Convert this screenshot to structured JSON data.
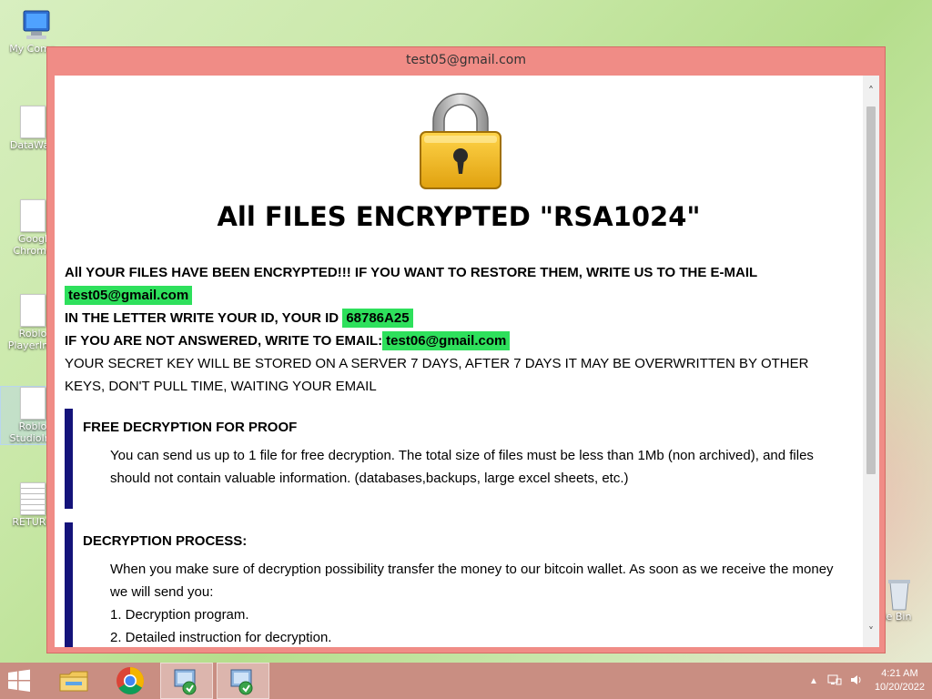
{
  "window": {
    "title": "test05@gmail.com"
  },
  "ransom_note": {
    "heading": "All FILES ENCRYPTED \"RSA1024\"",
    "line1": "All YOUR FILES HAVE BEEN ENCRYPTED!!! IF YOU WANT TO RESTORE THEM, WRITE US TO THE E-MAIL",
    "email_primary": "test05@gmail.com",
    "line2_prefix": "IN THE LETTER WRITE YOUR ID, YOUR ID",
    "victim_id": "68786A25",
    "line3_prefix": "IF YOU ARE NOT ANSWERED, WRITE TO EMAIL:",
    "email_secondary": "test06@gmail.com",
    "line4": "YOUR SECRET KEY WILL BE STORED ON A SERVER 7 DAYS, AFTER 7 DAYS IT MAY BE OVERWRITTEN BY OTHER KEYS, DON'T PULL TIME, WAITING YOUR EMAIL",
    "sections": [
      {
        "title": "FREE DECRYPTION FOR PROOF",
        "body": "You can send us up to 1 file for free decryption. The total size of files must be less than 1Mb (non archived), and files should not contain valuable information. (databases,backups, large excel sheets, etc.)"
      },
      {
        "title": "DECRYPTION PROCESS:",
        "body": "When you make sure of decryption possibility transfer the money to our bitcoin wallet. As soon as we receive the money we will send you:",
        "items": [
          "1. Decryption program.",
          "2. Detailed instruction for decryption."
        ]
      }
    ]
  },
  "desktop_icons": [
    {
      "label": "My Comp",
      "icon": "computer-icon"
    },
    {
      "label": "DataWag",
      "icon": "document-icon"
    },
    {
      "label": "Googl Chrome",
      "icon": "document-icon"
    },
    {
      "label": "Roblo PlayerInst",
      "icon": "document-icon"
    },
    {
      "label": "Roblo StudioIns",
      "icon": "document-icon"
    },
    {
      "label": "RETURN",
      "icon": "text-file-icon"
    },
    {
      "label": "le Bin",
      "icon": "recycle-bin-icon"
    }
  ],
  "taskbar": {
    "time": "4:21 AM",
    "date": "10/20/2022",
    "apps": [
      "file-explorer-icon",
      "chrome-icon",
      "installer-icon",
      "installer-icon"
    ]
  },
  "colors": {
    "window_frame": "#f08c86",
    "highlight": "#2ee05c",
    "section_bar": "#14137a",
    "taskbar": "#c98e82"
  }
}
